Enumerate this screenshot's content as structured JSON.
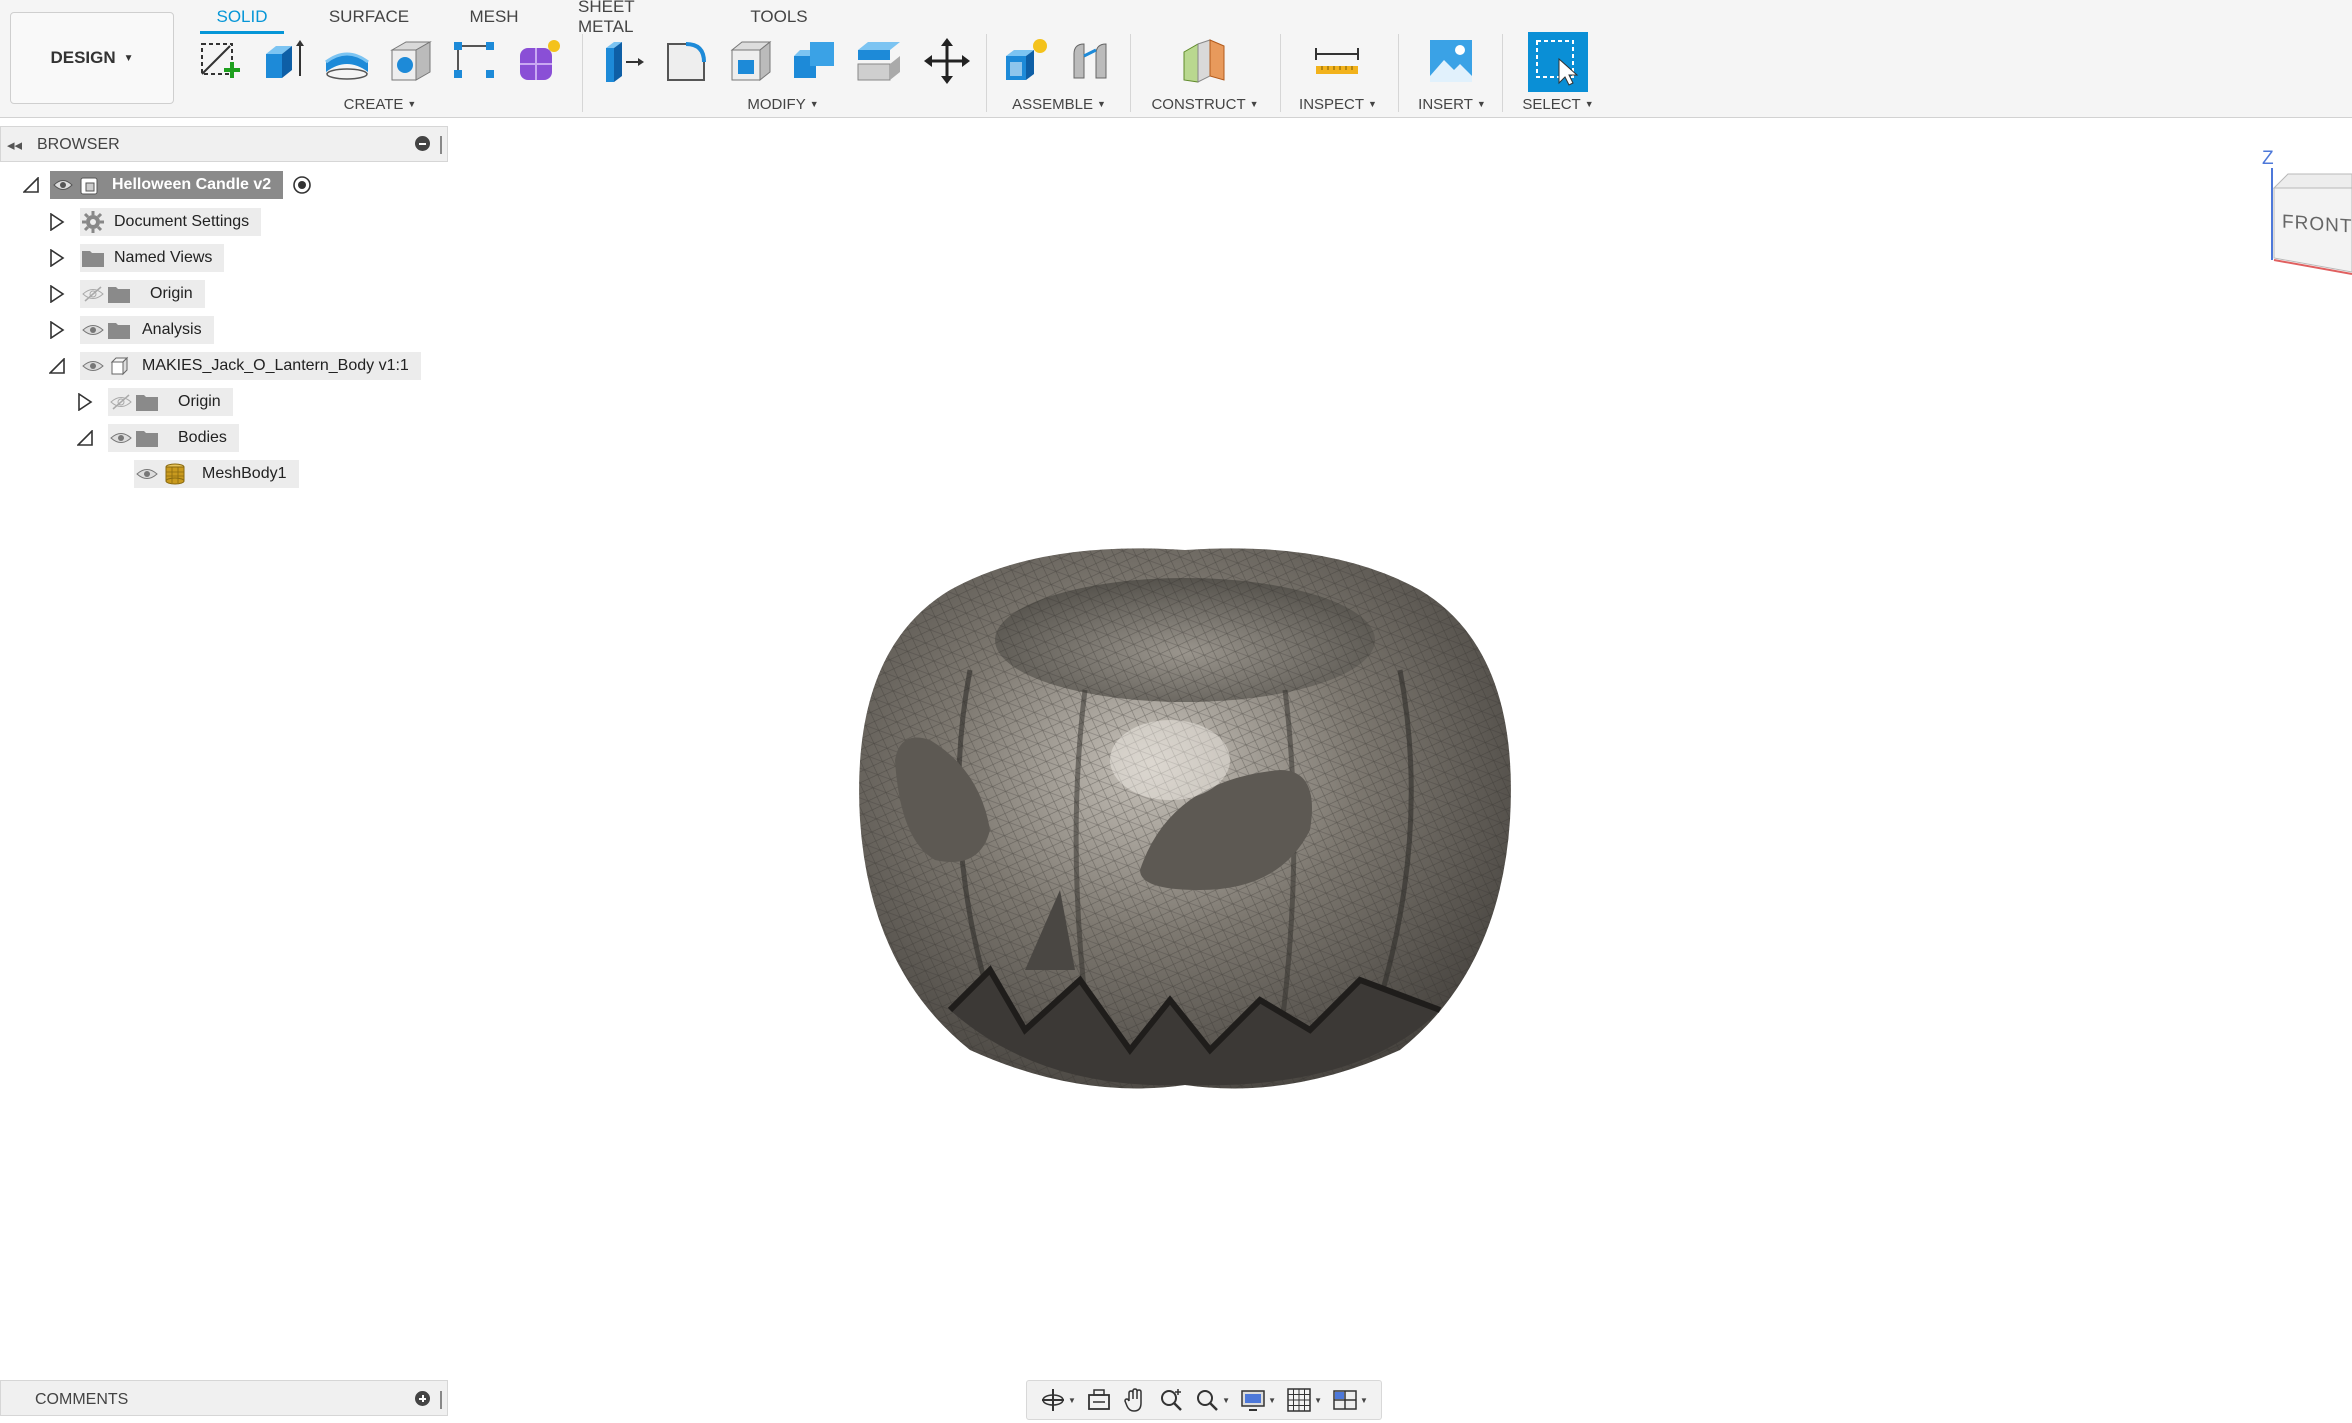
{
  "workspace": {
    "label": "DESIGN"
  },
  "tabs": [
    {
      "label": "SOLID",
      "active": true
    },
    {
      "label": "SURFACE",
      "active": false
    },
    {
      "label": "MESH",
      "active": false
    },
    {
      "label": "SHEET METAL",
      "active": false
    },
    {
      "label": "TOOLS",
      "active": false
    }
  ],
  "groups": {
    "create": "CREATE",
    "modify": "MODIFY",
    "assemble": "ASSEMBLE",
    "construct": "CONSTRUCT",
    "inspect": "INSPECT",
    "insert": "INSERT",
    "select": "SELECT"
  },
  "browser": {
    "title": "BROWSER",
    "tree": {
      "root": "Helloween Candle v2",
      "document_settings": "Document Settings",
      "named_views": "Named Views",
      "origin": "Origin",
      "analysis": "Analysis",
      "component": "MAKIES_Jack_O_Lantern_Body v1:1",
      "component_origin": "Origin",
      "bodies": "Bodies",
      "mesh_body": "MeshBody1"
    }
  },
  "comments": {
    "title": "COMMENTS"
  },
  "viewcube": {
    "face": "FRONT",
    "axis": "Z"
  },
  "colors": {
    "accent": "#0696d7",
    "mesh_body": "#6e6b66",
    "select_active": "#0a8fd6"
  }
}
